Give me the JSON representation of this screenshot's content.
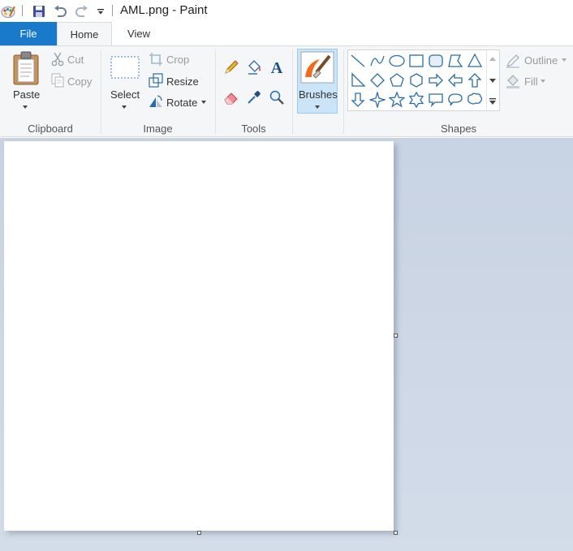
{
  "window": {
    "title": "AML.png - Paint"
  },
  "quick_access": {
    "icons": [
      "paint-app-icon",
      "save-icon",
      "undo-icon",
      "redo-icon",
      "customize-dropdown-icon"
    ]
  },
  "tabs": [
    {
      "label": "File"
    },
    {
      "label": "Home"
    },
    {
      "label": "View"
    }
  ],
  "clipboard": {
    "group_label": "Clipboard",
    "paste_label": "Paste",
    "cut_label": "Cut",
    "copy_label": "Copy"
  },
  "image": {
    "group_label": "Image",
    "select_label": "Select",
    "crop_label": "Crop",
    "resize_label": "Resize",
    "rotate_label": "Rotate"
  },
  "tools": {
    "group_label": "Tools",
    "items": [
      "pencil-icon",
      "fill-bucket-icon",
      "text-icon",
      "eraser-icon",
      "color-picker-icon",
      "magnifier-icon"
    ]
  },
  "brushes": {
    "label": "Brushes"
  },
  "shapes": {
    "group_label": "Shapes",
    "outline_label": "Outline",
    "fill_label": "Fill"
  },
  "colors": {
    "accent": "#1979ca",
    "ribbon_bg": "#f5f6f7",
    "selected_button": "#cce4f7",
    "workspace_bg": "#c8d3e3",
    "icon_blue": "#2a6ea8"
  }
}
